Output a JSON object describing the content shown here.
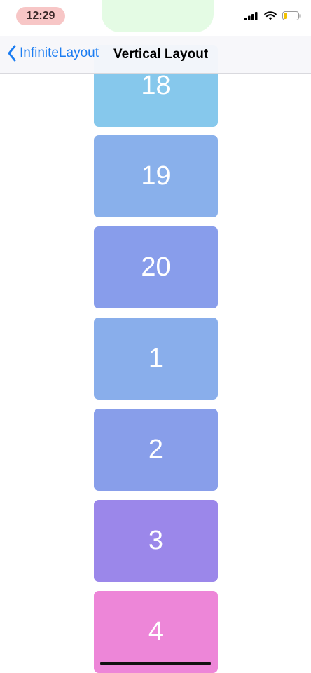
{
  "status_bar": {
    "time": "12:29",
    "icons": [
      "signal-icon",
      "wifi-icon",
      "battery-icon"
    ]
  },
  "nav": {
    "back_label": "InfiniteLayout",
    "title": "Vertical Layout"
  },
  "cells": [
    {
      "label": "18",
      "color": "#86c8ec"
    },
    {
      "label": "19",
      "color": "#89b0eb"
    },
    {
      "label": "20",
      "color": "#889deb"
    },
    {
      "label": "1",
      "color": "#89aeeb"
    },
    {
      "label": "2",
      "color": "#889eea"
    },
    {
      "label": "3",
      "color": "#9b87ea"
    },
    {
      "label": "4",
      "color": "#ed86d8"
    }
  ]
}
